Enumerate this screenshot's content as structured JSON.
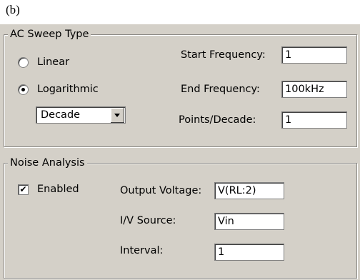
{
  "caption": "(b)",
  "ac_sweep": {
    "title": "AC Sweep Type",
    "linear_label": "Linear",
    "log_label": "Logarithmic",
    "selected": "Logarithmic",
    "scale_value": "Decade",
    "start_label": "Start Frequency:",
    "start_value": "1",
    "end_label": "End Frequency:",
    "end_value": "100kHz",
    "points_label": "Points/Decade:",
    "points_value": "1"
  },
  "noise": {
    "title": "Noise Analysis",
    "enabled_label": "Enabled",
    "enabled_checked": true,
    "output_label": "Output Voltage:",
    "output_value": "V(RL:2)",
    "source_label": "I/V Source:",
    "source_value": "Vin",
    "interval_label": "Interval:",
    "interval_value": "1"
  }
}
